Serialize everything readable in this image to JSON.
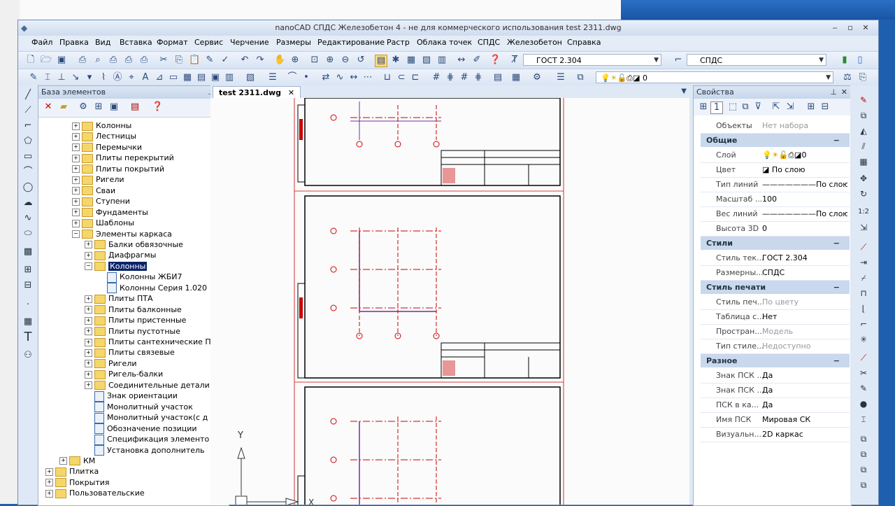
{
  "window": {
    "title": "nanoCAD СПДС Железобетон 4 - не для коммерческого использования test 2311.dwg",
    "min": "‒",
    "max": "▫",
    "close": "✕"
  },
  "menu": [
    "Файл",
    "Правка",
    "Вид",
    "Вставка",
    "Формат",
    "Сервис",
    "Черчение",
    "Размеры",
    "Редактирование",
    "Растр",
    "Облака точек",
    "СПДС",
    "Железобетон",
    "Справка"
  ],
  "toolbar": {
    "text_style": "ГОСТ 2.304",
    "dim_style": "СПДС",
    "layer_value": "0"
  },
  "element_base": {
    "title": "База элементов",
    "tree": [
      {
        "label": "Колонны",
        "level": 1,
        "kind": "folder",
        "exp": "+"
      },
      {
        "label": "Лестницы",
        "level": 1,
        "kind": "folder",
        "exp": "+"
      },
      {
        "label": "Перемычки",
        "level": 1,
        "kind": "folder",
        "exp": "+"
      },
      {
        "label": "Плиты перекрытий",
        "level": 1,
        "kind": "folder",
        "exp": "+"
      },
      {
        "label": "Плиты покрытий",
        "level": 1,
        "kind": "folder",
        "exp": "+"
      },
      {
        "label": "Ригели",
        "level": 1,
        "kind": "folder",
        "exp": "+"
      },
      {
        "label": "Сваи",
        "level": 1,
        "kind": "folder",
        "exp": "+"
      },
      {
        "label": "Ступени",
        "level": 1,
        "kind": "folder",
        "exp": "+"
      },
      {
        "label": "Фундаменты",
        "level": 1,
        "kind": "folder",
        "exp": "+"
      },
      {
        "label": "Шаблоны",
        "level": 1,
        "kind": "folder",
        "exp": "+"
      },
      {
        "label": "Элементы каркаса",
        "level": 1,
        "kind": "folder",
        "exp": "−"
      },
      {
        "label": "Балки обвязочные",
        "level": 2,
        "kind": "folder",
        "exp": "+"
      },
      {
        "label": "Диафрагмы",
        "level": 2,
        "kind": "folder",
        "exp": "+"
      },
      {
        "label": "Колонны",
        "level": 2,
        "kind": "folder",
        "exp": "−",
        "selected": true
      },
      {
        "label": "Колонны ЖБИ7",
        "level": 3,
        "kind": "doc"
      },
      {
        "label": "Колонны Серия 1.020",
        "level": 3,
        "kind": "doc"
      },
      {
        "label": "Плиты ПТА",
        "level": 2,
        "kind": "folder",
        "exp": "+"
      },
      {
        "label": "Плиты балконные",
        "level": 2,
        "kind": "folder",
        "exp": "+"
      },
      {
        "label": "Плиты пристенные",
        "level": 2,
        "kind": "folder",
        "exp": "+"
      },
      {
        "label": "Плиты пустотные",
        "level": 2,
        "kind": "folder",
        "exp": "+"
      },
      {
        "label": "Плиты сантехнические П",
        "level": 2,
        "kind": "folder",
        "exp": "+"
      },
      {
        "label": "Плиты связевые",
        "level": 2,
        "kind": "folder",
        "exp": "+"
      },
      {
        "label": "Ригели",
        "level": 2,
        "kind": "folder",
        "exp": "+"
      },
      {
        "label": "Ригель-балки",
        "level": 2,
        "kind": "folder",
        "exp": "+"
      },
      {
        "label": "Соединительные детали",
        "level": 2,
        "kind": "folder",
        "exp": "+"
      },
      {
        "label": "Знак ориентации",
        "level": 2,
        "kind": "doc"
      },
      {
        "label": "Монолитный участок",
        "level": 2,
        "kind": "doc"
      },
      {
        "label": "Монолитный участок(с д",
        "level": 2,
        "kind": "doc"
      },
      {
        "label": "Обозначение позиции",
        "level": 2,
        "kind": "doc"
      },
      {
        "label": "Спецификация элементо",
        "level": 2,
        "kind": "doc"
      },
      {
        "label": "Установка дополнитель",
        "level": 2,
        "kind": "doc"
      },
      {
        "label": "КМ",
        "level": 0.5,
        "kind": "folder",
        "exp": "+"
      },
      {
        "label": "Плитка",
        "level": 0,
        "kind": "folder",
        "exp": "+"
      },
      {
        "label": "Покрытия",
        "level": 0,
        "kind": "folder",
        "exp": "+"
      },
      {
        "label": "Пользовательские",
        "level": 0,
        "kind": "folder",
        "exp": "+"
      }
    ]
  },
  "document": {
    "tab_label": "test 2311.dwg",
    "tab_close": "✕",
    "ucs_y": "Y",
    "ucs_x": "X"
  },
  "properties": {
    "title": "Свойства",
    "objects_key": "Объекты",
    "objects_val": "Нет набора",
    "cat_general": "Общие",
    "cat_styles": "Стили",
    "cat_print": "Стиль печати",
    "cat_misc": "Разное",
    "rows": {
      "layer": {
        "k": "Слой",
        "v": "0"
      },
      "color": {
        "k": "Цвет",
        "v": "По слою"
      },
      "linetype": {
        "k": "Тип линий",
        "v": "По слою"
      },
      "scale": {
        "k": "Масштаб ...",
        "v": "100"
      },
      "lineweight": {
        "k": "Вес линий",
        "v": "По слою"
      },
      "height3d": {
        "k": "Высота 3D",
        "v": "0"
      },
      "textstyle": {
        "k": "Стиль тек...",
        "v": "ГОСТ 2.304"
      },
      "dimstyle": {
        "k": "Размерны...",
        "v": "СПДС"
      },
      "printstyle": {
        "k": "Стиль печ...",
        "v": "По цвету"
      },
      "table": {
        "k": "Таблица с...",
        "v": "Нет"
      },
      "space": {
        "k": "Простран...",
        "v": "Модель"
      },
      "styletype": {
        "k": "Тип стиле...",
        "v": "Недоступно"
      },
      "ucs1": {
        "k": "Знак ПСК ...",
        "v": "Да"
      },
      "ucs2": {
        "k": "Знак ПСК ...",
        "v": "Да"
      },
      "ucs3": {
        "k": "ПСК в ка...",
        "v": "Да"
      },
      "ucsname": {
        "k": "Имя ПСК",
        "v": "Мировая СК"
      },
      "visual": {
        "k": "Визуальн...",
        "v": "2D каркас"
      }
    }
  },
  "colors": {
    "accent": "#0a246a",
    "drawing_red": "#cc0000",
    "drawing_purple": "#7030a0"
  }
}
